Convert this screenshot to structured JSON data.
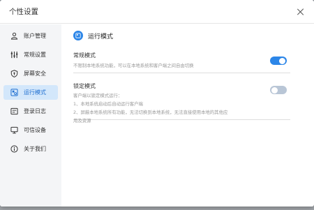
{
  "window": {
    "title": "个性设置"
  },
  "sidebar": {
    "items": [
      {
        "label": "账户管理",
        "icon": "user-icon"
      },
      {
        "label": "常规设置",
        "icon": "sliders-icon"
      },
      {
        "label": "屏幕安全",
        "icon": "shield-icon"
      },
      {
        "label": "运行模式",
        "icon": "run-mode-icon",
        "active": true
      },
      {
        "label": "登录日志",
        "icon": "login-log-icon"
      },
      {
        "label": "可信设备",
        "icon": "monitor-icon"
      },
      {
        "label": "关于我们",
        "icon": "info-icon"
      }
    ]
  },
  "main": {
    "section_title": "运行模式",
    "normal_mode": {
      "title": "常规模式",
      "description": "不限制本地系统功能，可以在本地系统和客户端之间自由切换",
      "enabled": true
    },
    "locked_mode": {
      "title": "锁定模式",
      "description_lines": [
        "客户端以锁定模式运行：",
        "1、本地系统启动后自动运行客户端",
        "2、屏蔽本地系统所有功能，无法切换到本地系统，无法直接使用本地的其他应",
        "用及资源"
      ],
      "enabled": false
    }
  },
  "colors": {
    "accent": "#2c86e8",
    "active_nav_bg": "#d3e7fb",
    "toggle_off": "#b9c6d6"
  }
}
